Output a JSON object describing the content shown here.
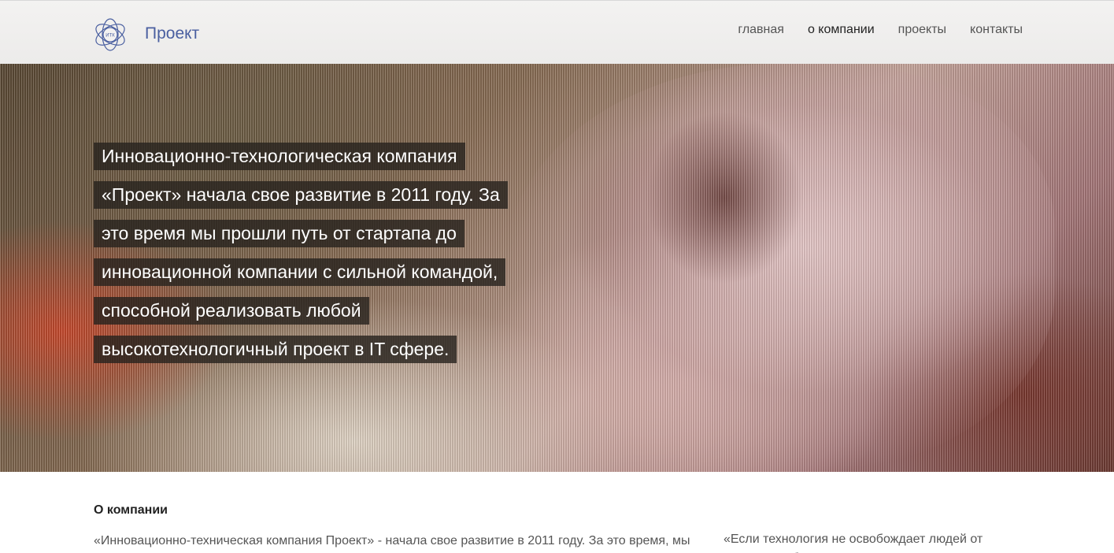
{
  "header": {
    "logo_text": "Проект",
    "logo_badge": "ИТК",
    "nav": [
      {
        "label": "главная"
      },
      {
        "label": "о компании"
      },
      {
        "label": "проекты"
      },
      {
        "label": "контакты"
      }
    ]
  },
  "hero": {
    "lines": [
      "Инновационно-технологическая компания",
      "«Проект» начала свое развитие в 2011 году. За",
      "это время мы прошли путь от стартапа до",
      "инновационной компании с сильной командой,",
      "способной реализовать любой",
      "высокотехнологичный проект в IT сфере."
    ]
  },
  "content": {
    "title": "О компании",
    "about_text": "«Инновационно-техническая компания Проект» - начала свое развитие в 2011 году. За это время, мы прошли путь от стартапа до инновационной компании с сильной командой. Наша команда имеет",
    "quote_text": "«Если технология не освобождает людей от рутины, чтобы они могли преследовать"
  }
}
